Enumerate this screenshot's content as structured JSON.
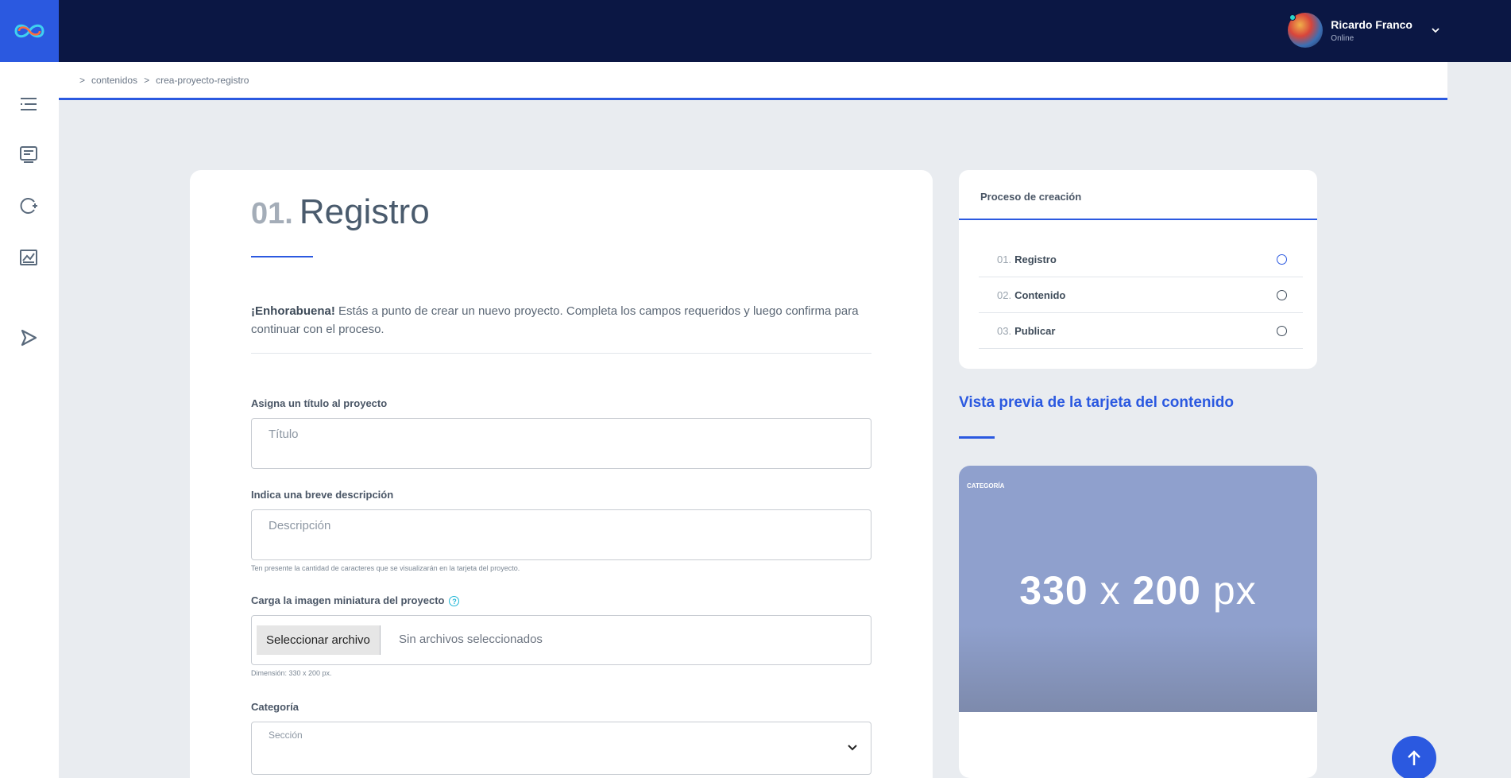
{
  "header": {
    "user_name": "Ricardo Franco",
    "user_status": "Online"
  },
  "breadcrumb": {
    "items": [
      "contenidos",
      "crea-proyecto-registro"
    ],
    "separator": ">"
  },
  "form": {
    "step_number": "01.",
    "step_title": "Registro",
    "intro_bold": "¡Enhorabuena!",
    "intro_text": " Estás a punto de crear un nuevo proyecto. Completa los campos requeridos y luego confirma para continuar con el proceso.",
    "title_label": "Asigna un título al proyecto",
    "title_placeholder": "Título",
    "desc_label": "Indica una breve descripción",
    "desc_placeholder": "Descripción",
    "desc_hint": "Ten presente la cantidad de caracteres que se visualizarán en la tarjeta del proyecto.",
    "image_label": "Carga la imagen miniatura del proyecto",
    "help_glyph": "?",
    "file_button": "Seleccionar archivo",
    "file_status": "Sin archivos seleccionados",
    "image_hint": "Dimensión: 330 x 200 px.",
    "category_label": "Categoría",
    "category_placeholder": "Sección"
  },
  "process": {
    "title": "Proceso de creación",
    "steps": [
      {
        "num": "01.",
        "label": "Registro",
        "active": true
      },
      {
        "num": "02.",
        "label": "Contenido",
        "active": false
      },
      {
        "num": "03.",
        "label": "Publicar",
        "active": false
      }
    ]
  },
  "preview": {
    "title": "Vista previa de la tarjeta del contenido",
    "category": "CATEGORÍA",
    "dim_w": "330",
    "dim_x": "x",
    "dim_h": "200",
    "dim_unit": "px"
  },
  "colors": {
    "accent": "#2b59e0",
    "topbar": "#0b1744",
    "online_dot": "#2ad6c8"
  },
  "icons": [
    "infinity-logo-icon",
    "list-icon",
    "document-icon",
    "refresh-add-icon",
    "chart-icon",
    "play-icon",
    "chevron-down-icon",
    "arrow-up-icon"
  ]
}
